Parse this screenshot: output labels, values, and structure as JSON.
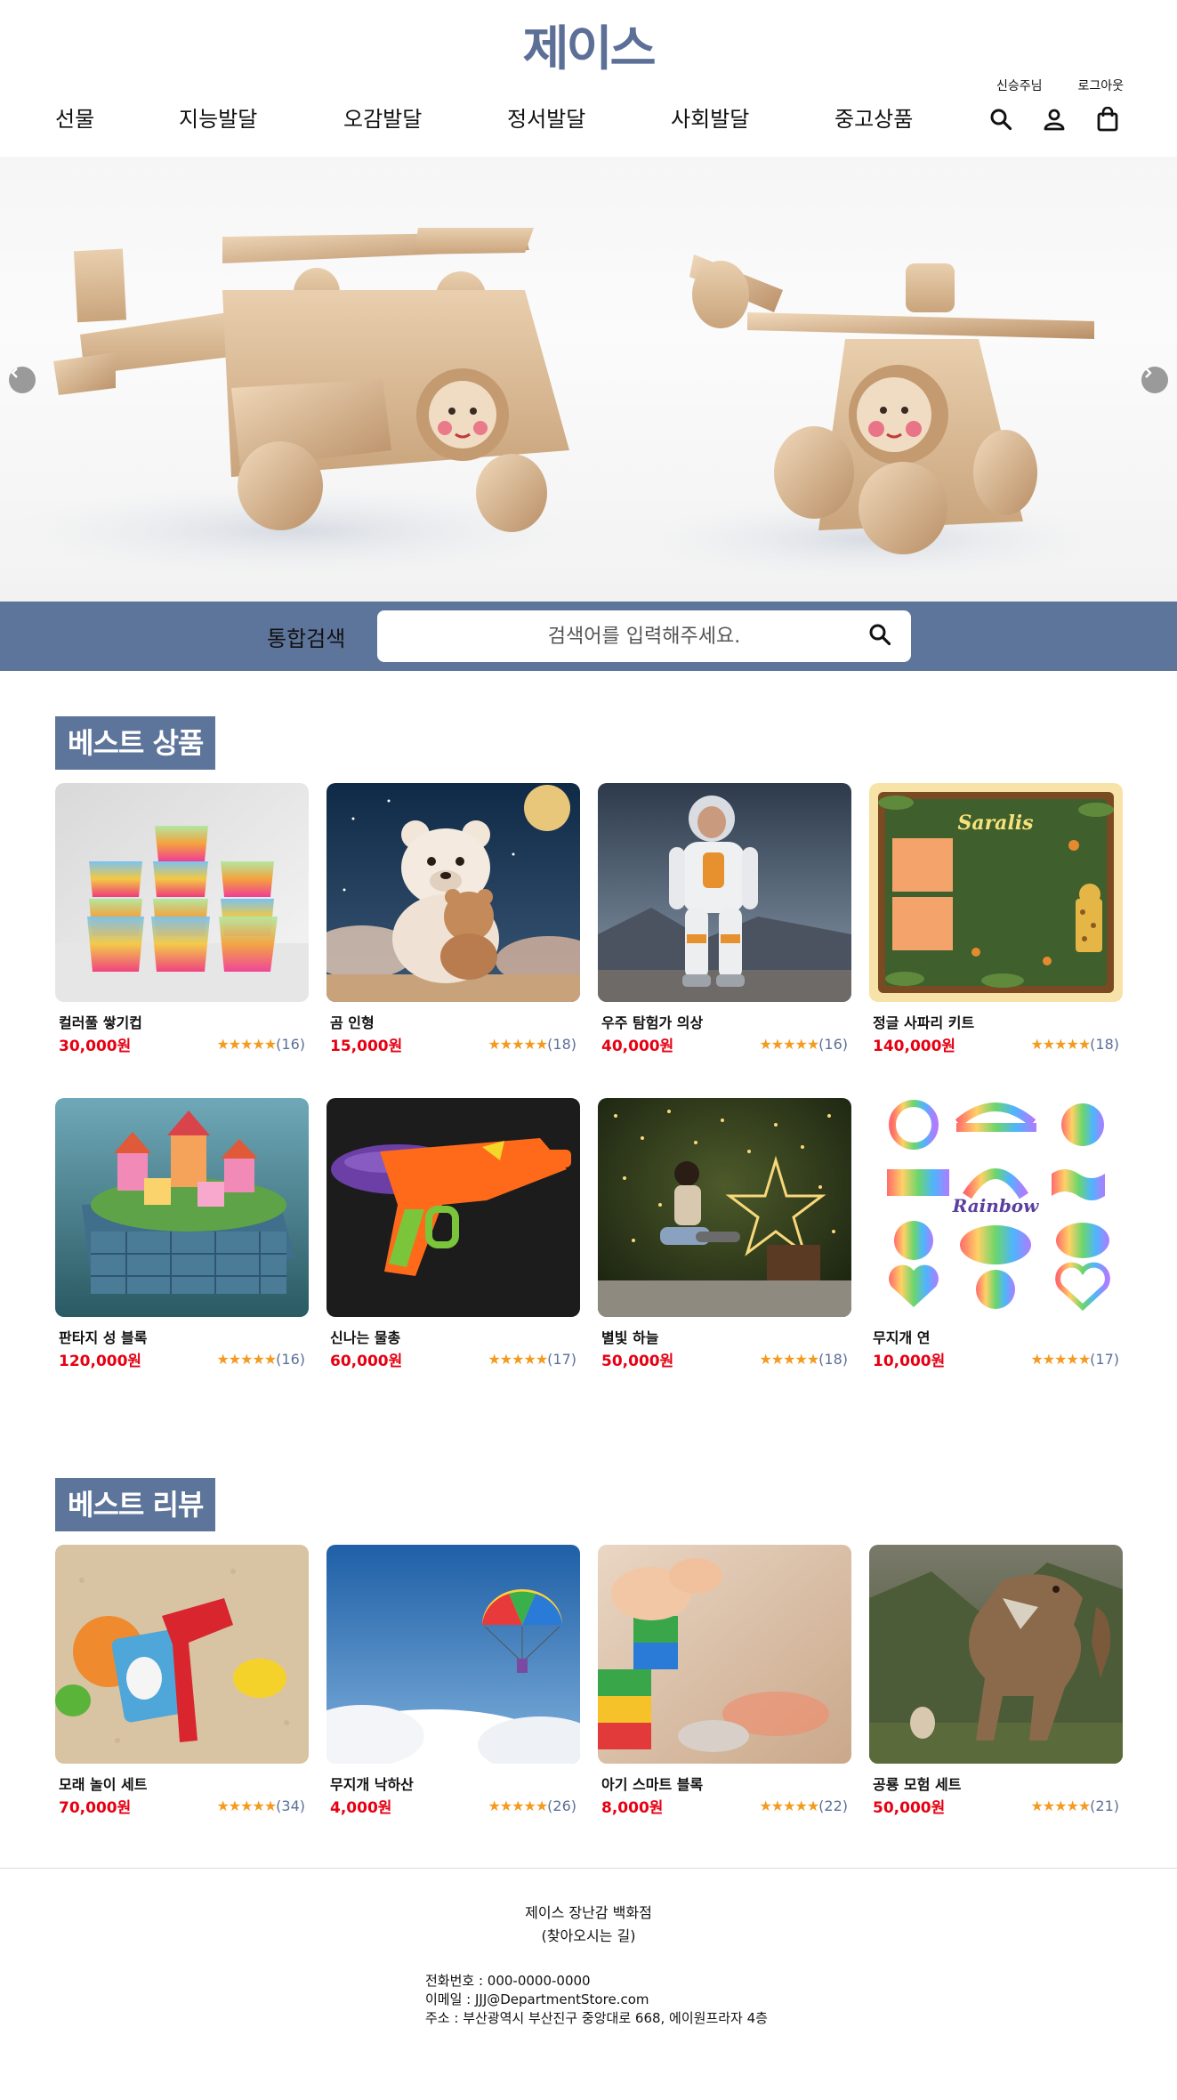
{
  "header": {
    "logo_text": "제이스",
    "user_name": "신승주님",
    "logout_label": "로그아웃",
    "nav": [
      "선물",
      "지능발달",
      "오감발달",
      "정서발달",
      "사회발달",
      "중고상품"
    ],
    "icons": [
      "search-icon",
      "user-icon",
      "shopping-bag-icon"
    ]
  },
  "hero": {
    "image": "wooden-toy-helicopters",
    "prev_icon": "chevron-left-icon",
    "next_icon": "chevron-right-icon"
  },
  "search": {
    "label": "통합검색",
    "placeholder": "검색어를 입력해주세요.",
    "button_icon": "search-icon"
  },
  "best_products": {
    "title": "베스트 상품",
    "items": [
      {
        "name": "컬러풀 쌓기컵",
        "price": "30,000원",
        "stars": "★★★★★",
        "count": "(16)"
      },
      {
        "name": "곰 인형",
        "price": "15,000원",
        "stars": "★★★★★",
        "count": "(18)"
      },
      {
        "name": "우주 탐험가 의상",
        "price": "40,000원",
        "stars": "★★★★★",
        "count": "(16)"
      },
      {
        "name": "정글 사파리 키트",
        "price": "140,000원",
        "stars": "★★★★★",
        "count": "(18)"
      },
      {
        "name": "판타지 성 블록",
        "price": "120,000원",
        "stars": "★★★★★",
        "count": "(16)"
      },
      {
        "name": "신나는 물총",
        "price": "60,000원",
        "stars": "★★★★★",
        "count": "(17)"
      },
      {
        "name": "별빛 하늘",
        "price": "50,000원",
        "stars": "★★★★★",
        "count": "(18)"
      },
      {
        "name": "무지개 연",
        "price": "10,000원",
        "stars": "★★★★★",
        "count": "(17)"
      }
    ],
    "thumb_texts": {
      "saralis": "Saralis",
      "rainbow": "Rainbow"
    }
  },
  "best_reviews": {
    "title": "베스트 리뷰",
    "items": [
      {
        "name": "모래 놀이 세트",
        "price": "70,000원",
        "stars": "★★★★★",
        "count": "(34)"
      },
      {
        "name": "무지개 낙하산",
        "price": "4,000원",
        "stars": "★★★★★",
        "count": "(26)"
      },
      {
        "name": "아기 스마트 블록",
        "price": "8,000원",
        "stars": "★★★★★",
        "count": "(22)"
      },
      {
        "name": "공룡 모험 세트",
        "price": "50,000원",
        "stars": "★★★★★",
        "count": "(21)"
      }
    ]
  },
  "footer": {
    "store_name": "제이스 장난감 백화점",
    "directions": "(찾아오시는 길)",
    "phone": "전화번호 : 000-0000-0000",
    "email": "이메일 : JJJ@DepartmentStore.com",
    "address": "주소 : 부산광역시 부산진구 중앙대로 668, 에이원프라자 4층"
  },
  "colors": {
    "brand": "#5e759b",
    "price": "#e60012",
    "star": "#f39a1f"
  }
}
